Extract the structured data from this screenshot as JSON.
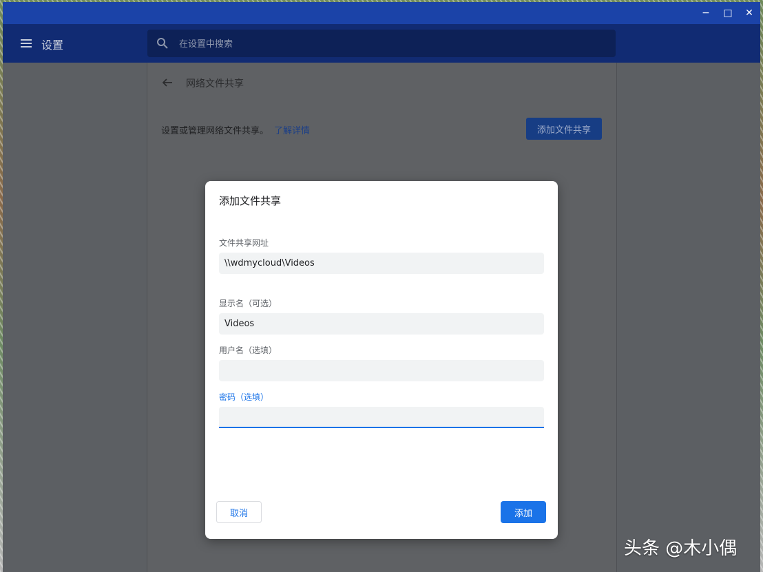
{
  "window": {
    "controls": {
      "minimize": "−",
      "maximize": "□",
      "close": "✕"
    }
  },
  "header": {
    "app_title": "设置",
    "search_placeholder": "在设置中搜索",
    "menu_icon": "menu-icon",
    "search_icon": "search-icon"
  },
  "page": {
    "title": "网络文件共享",
    "description": "设置或管理网络文件共享。",
    "learn_more": "了解详情",
    "add_share_button": "添加文件共享"
  },
  "dialog": {
    "title": "添加文件共享",
    "fields": [
      {
        "label": "文件共享网址",
        "value": "\\\\wdmycloud\\Videos"
      },
      {
        "label": "显示名（可选）",
        "value": "Videos"
      },
      {
        "label": "用户名（选填）",
        "value": ""
      },
      {
        "label": "密码（选填）",
        "value": ""
      }
    ],
    "cancel_label": "取消",
    "add_label": "添加"
  },
  "watermark": "头条 @木小偶",
  "colors": {
    "titlebar": "#1b43a8",
    "header": "#112b73",
    "accent": "#1a73e8"
  }
}
